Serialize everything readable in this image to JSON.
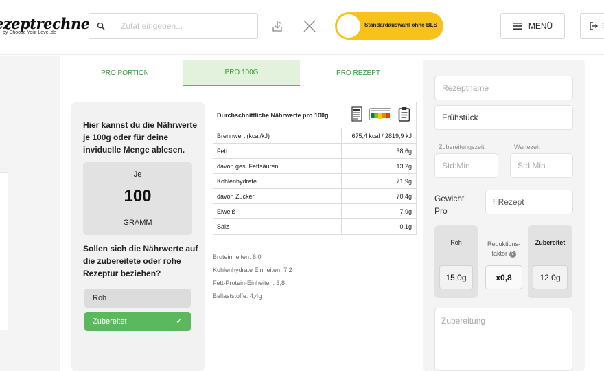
{
  "header": {
    "logo_text": "ezeptrechner",
    "logo_sub": "by Choose Your Level.de",
    "search_placeholder": "Zutat eingeben...",
    "toggle_label": "Standardauswahl ohne BLS",
    "toggle_color": "#f7c31a",
    "menu_label": "MENÜ"
  },
  "tabs": [
    {
      "label": "PRO PORTION",
      "active": false
    },
    {
      "label": "PRO 100G",
      "active": true
    },
    {
      "label": "PRO REZEPT",
      "active": false
    }
  ],
  "info": {
    "text": "Hier kannst du die Nährwerte je 100g oder für deine invidueIle Menge ablesen.",
    "amount_prefix": "Je",
    "amount_value": "100",
    "amount_unit": "GRAMM",
    "question": "Sollen sich die Nährwerte auf die zubereitete oder rohe Rezeptur beziehen?",
    "option_raw": "Roh",
    "option_prepared": "Zubereitet",
    "selected": "Zubereitet"
  },
  "nutrition": {
    "title": "Durchschnittliche Nährwerte pro 100g",
    "rows": [
      {
        "label": "Brennwert (kcal/kJ)",
        "value": "675,4 kcal / 2819,9 kJ"
      },
      {
        "label": "Fett",
        "value": "38,6g"
      },
      {
        "label": "davon ges. Fettsäuren",
        "value": "13,2g"
      },
      {
        "label": "Kohlenhydrate",
        "value": "71,9g"
      },
      {
        "label": "davon Zucker",
        "value": "70,4g"
      },
      {
        "label": "Eiweiß",
        "value": "7,9g"
      },
      {
        "label": "Salz",
        "value": "0,1g"
      }
    ],
    "extras": [
      "Broteinheiten: 6,0",
      "Kohlenhydrate Einheiten: 7,2",
      "Fett-Protein-Einheiten: 3,8",
      "Ballaststoffe: 4,4g"
    ]
  },
  "recipe": {
    "name_placeholder": "Rezeptname",
    "category_value": "Frühstück",
    "prep_time_label": "Zubereitungszeit",
    "wait_time_label": "Wartezeit",
    "time_placeholder": "Std:Min",
    "weight_label_1": "Gewicht",
    "weight_label_2": "Pro",
    "weight_select": "Rezept",
    "raw_label": "Roh",
    "raw_value": "15,0g",
    "reduction_label_1": "Reduktions-",
    "reduction_label_2": "faktor",
    "reduction_value": "x0,8",
    "prepared_label": "Zubereitet",
    "prepared_value": "12,0g",
    "preparation_placeholder": "Zubereitung"
  }
}
